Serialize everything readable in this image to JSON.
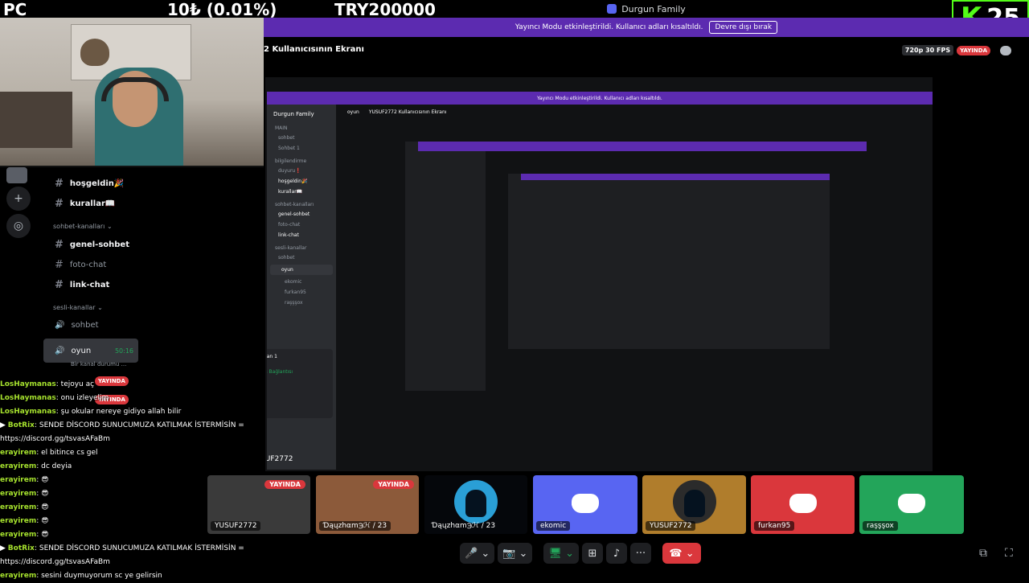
{
  "overlay": {
    "pc_label": "PC",
    "donation": "10₺ (0.01%)",
    "goal": "TRY200000",
    "kick_letter": "K",
    "kick_count": "25",
    "kick_color": "#53fc18"
  },
  "window": {
    "title": "Durgun Family"
  },
  "banner": {
    "text": "Yayıncı Modu etkinleştirildi. Kullanıcı adları kısaltıldı.",
    "button": "Devre dışı bırak",
    "color": "#5c2bb0"
  },
  "channel_header": {
    "title": "2 Kullanıcısının Ekranı",
    "quality": "720p 30 FPS",
    "live": "YAYINDA"
  },
  "guild_icons": [
    "plus-icon",
    "compass-icon"
  ],
  "channels": {
    "text": [
      {
        "name": "hoşgeldin🎉"
      },
      {
        "name": "kurallar📖"
      }
    ],
    "category_chat": "sohbet-kanalları",
    "chat_channels": [
      {
        "name": "genel-sohbet"
      },
      {
        "name": "foto-chat"
      },
      {
        "name": "link-chat"
      }
    ],
    "category_voice": "sesli-kanallar",
    "voice_channels": [
      {
        "name": "sohbet"
      },
      {
        "name": "oyun",
        "time": "50:16",
        "sub": "Bir kanal durumu ..."
      }
    ],
    "live_badge": "YAYINDA"
  },
  "nested": {
    "server": "Durgun Family",
    "channel": "oyun",
    "screen_title": "YUSUF2772 Kullanıcısının Ekranı",
    "categories": [
      "MAIN",
      "bilgilendirme",
      "sohbet-kanalları",
      "sesli-kanallar"
    ],
    "items": [
      "sohbet",
      "Sohbet 1",
      "duyuru❗",
      "hoşgeldin🎉",
      "kurallar📖",
      "genel-sohbet",
      "foto-chat",
      "link-chat",
      "sohbet",
      "oyun"
    ],
    "users": [
      "ekomic",
      "furkan95",
      "raşşşox"
    ],
    "ekran_label": "Ekran 1",
    "voice_connected": "Ses Bağlantısı",
    "footer_user": "YUSUF2772"
  },
  "tiles": [
    {
      "name": "YUSUF2772",
      "live": "YAYINDA",
      "bg": "#3a3a3a"
    },
    {
      "name": "Ɗąųzhαm℈ℋ / 23",
      "live": "YAYINDA",
      "bg": "#8c5a3a"
    },
    {
      "name": "Ɗąųzhαm℈ℋ / 23",
      "live": "",
      "bg": "#05070b"
    },
    {
      "name": "ekomic",
      "live": "",
      "bg": "#5865f2"
    },
    {
      "name": "YUSUF2772",
      "live": "",
      "bg": "#b07d2c"
    },
    {
      "name": "furkan95",
      "live": "",
      "bg": "#da373c"
    },
    {
      "name": "raşşşox",
      "live": "",
      "bg": "#23a55a"
    }
  ],
  "controls": {
    "mic": "🎤",
    "camera_off": "📷",
    "share": "🖥",
    "activities": "⊞",
    "soundboard": "♪",
    "more": "···",
    "hangup": "☎"
  },
  "chat": [
    {
      "user": "LosHaymanas",
      "text": ": tejoyu aç"
    },
    {
      "user": "LosHaymanas",
      "text": ": onu izleyelim"
    },
    {
      "user": "LosHaymanas",
      "text": ": şu okular nereye gidiyo allah bilir"
    },
    {
      "user": "BotRix",
      "text": ": SENDE DİSCORD SUNUCUMUZA KATILMAK İSTERMİSİN ="
    },
    {
      "user": "",
      "text": "https://discord.gg/tsvasAFaBm"
    },
    {
      "user": "erayirem",
      "text": ": el bitince cs gel"
    },
    {
      "user": "erayirem",
      "text": ": dc deyia"
    },
    {
      "user": "erayirem",
      "text": ": 😎"
    },
    {
      "user": "erayirem",
      "text": ": 😎"
    },
    {
      "user": "erayirem",
      "text": ": 😎"
    },
    {
      "user": "erayirem",
      "text": ": 😎"
    },
    {
      "user": "erayirem",
      "text": ": 😎"
    },
    {
      "user": "BotRix",
      "text": ": SENDE DİSCORD SUNUCUMUZA KATILMAK İSTERMİSİN ="
    },
    {
      "user": "",
      "text": "https://discord.gg/tsvasAFaBm"
    },
    {
      "user": "erayirem",
      "text": ": sesini duymuyorum sc ye gelirsin"
    }
  ]
}
